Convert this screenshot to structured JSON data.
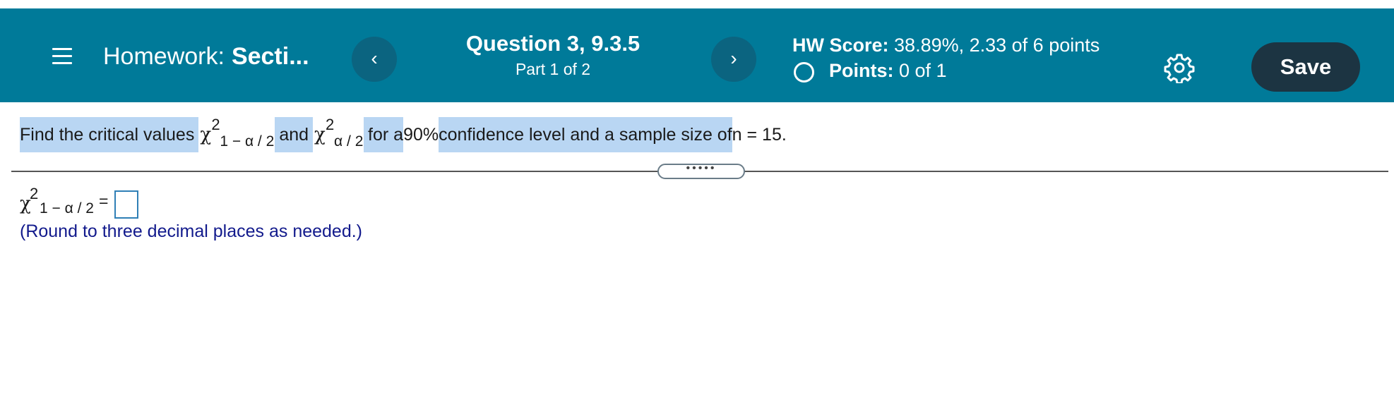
{
  "header": {
    "menu_icon": "hamburger-menu-icon",
    "hw_label": "Homework:",
    "hw_name": "Secti...",
    "prev_glyph": "‹",
    "next_glyph": "›",
    "question_title": "Question 3, 9.3.5",
    "question_part": "Part 1 of 2",
    "score_label": "HW Score:",
    "score_value": " 38.89%, 2.33 of 6 points",
    "points_label": "Points:",
    "points_value": " 0 of 1",
    "settings_icon": "gear-icon",
    "save_label": "Save"
  },
  "question": {
    "intro": "Find the critical values ",
    "chi": "χ",
    "sup": "2",
    "sub_lower": "1 − α / 2",
    "and": "and",
    "sub_upper": "α / 2",
    "mid1": "for a ",
    "confidence": "90%",
    "mid2": " confidence level and a sample size of ",
    "n_var": "n",
    "n_value": " = 15."
  },
  "expander": {
    "dots": "•••••"
  },
  "answer": {
    "chi": "χ",
    "sup": "2",
    "sub": "1 − α / 2",
    "equals": "=",
    "value": "",
    "hint": "(Round to three decimal places as needed.)"
  },
  "colors": {
    "header_bg": "#007a99",
    "nav_button": "#0b6480",
    "save_button": "#1c3442",
    "highlight": "#b9d6f3",
    "hint_text": "#121a8c",
    "input_border": "#2f7fb6"
  }
}
